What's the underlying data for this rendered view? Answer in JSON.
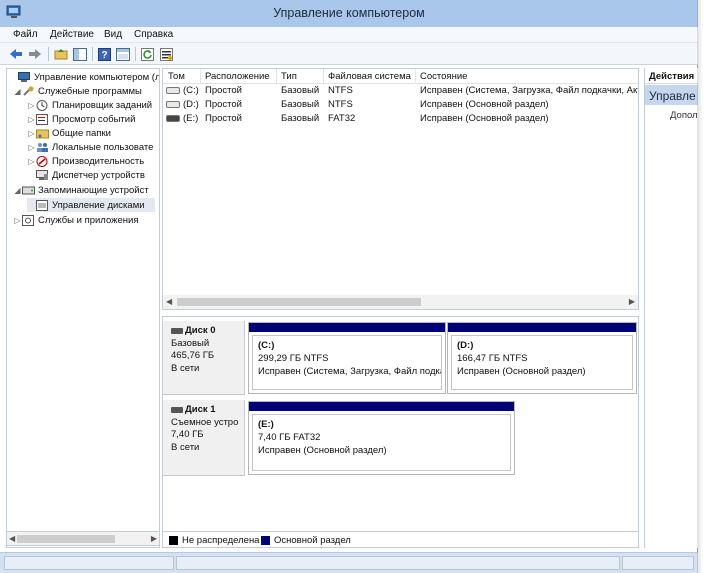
{
  "window": {
    "title": "Управление компьютером"
  },
  "menu": [
    {
      "label": "Файл"
    },
    {
      "label": "Действие"
    },
    {
      "label": "Вид"
    },
    {
      "label": "Справка"
    }
  ],
  "toolbar": {
    "buttons": [
      "back-arrow-icon",
      "forward-arrow-icon",
      "folder-up-icon",
      "show-hide-tree-icon",
      "help-icon",
      "show-hide-action-pane-icon",
      "refresh-icon",
      "properties-icon"
    ]
  },
  "tree": {
    "items": [
      {
        "label": "Управление компьютером (л",
        "icon": "computer-icon"
      },
      {
        "label": "Служебные программы",
        "icon": "tools-icon"
      },
      {
        "label": "Планировщик заданий",
        "icon": "clock-icon"
      },
      {
        "label": "Просмотр событий",
        "icon": "event-viewer-icon"
      },
      {
        "label": "Общие папки",
        "icon": "shared-folder-icon"
      },
      {
        "label": "Локальные пользовате",
        "icon": "users-icon"
      },
      {
        "label": "Производительность",
        "icon": "performance-icon"
      },
      {
        "label": "Диспетчер устройств",
        "icon": "device-manager-icon"
      },
      {
        "label": "Запоминающие устройст",
        "icon": "storage-icon"
      },
      {
        "label": "Управление дисками",
        "icon": "disk-management-icon"
      },
      {
        "label": "Службы и приложения",
        "icon": "services-icon"
      }
    ]
  },
  "volumes": {
    "columns": [
      "Том",
      "Расположение",
      "Тип",
      "Файловая система",
      "Состояние"
    ],
    "rows": [
      {
        "tom": "(C:)",
        "loc": "Простой",
        "type": "Базовый",
        "fs": "NTFS",
        "status": "Исправен (Система, Загрузка, Файл подкачки, Акт"
      },
      {
        "tom": "(D:)",
        "loc": "Простой",
        "type": "Базовый",
        "fs": "NTFS",
        "status": "Исправен (Основной раздел)"
      },
      {
        "tom": "(E:)",
        "loc": "Простой",
        "type": "Базовый",
        "fs": "FAT32",
        "status": "Исправен (Основной раздел)"
      }
    ]
  },
  "disks": [
    {
      "name": "Диск 0",
      "kind": "Базовый",
      "size": "465,76 ГБ",
      "state": "В сети",
      "partitions": [
        {
          "name": "(C:)",
          "size": "299,29 ГБ NTFS",
          "status": "Исправен (Система, Загрузка, Файл подка"
        },
        {
          "name": "(D:)",
          "size": "166,47 ГБ NTFS",
          "status": "Исправен (Основной раздел)"
        }
      ]
    },
    {
      "name": "Диск 1",
      "kind": "Съемное устро",
      "size": "7,40 ГБ",
      "state": "В сети",
      "partitions": [
        {
          "name": "(E:)",
          "size": "7,40 ГБ FAT32",
          "status": "Исправен (Основной раздел)"
        }
      ]
    }
  ],
  "legend": [
    {
      "label": "Не распределена",
      "color": "#000000"
    },
    {
      "label": "Основной раздел",
      "color": "#000078"
    }
  ],
  "actions": {
    "title": "Действия",
    "subtitle": "Управле",
    "more": "Допол"
  },
  "colors": {
    "titlebar": "#a9c7ea",
    "partition_bar": "#000078",
    "selection": "#e3e9f0"
  }
}
